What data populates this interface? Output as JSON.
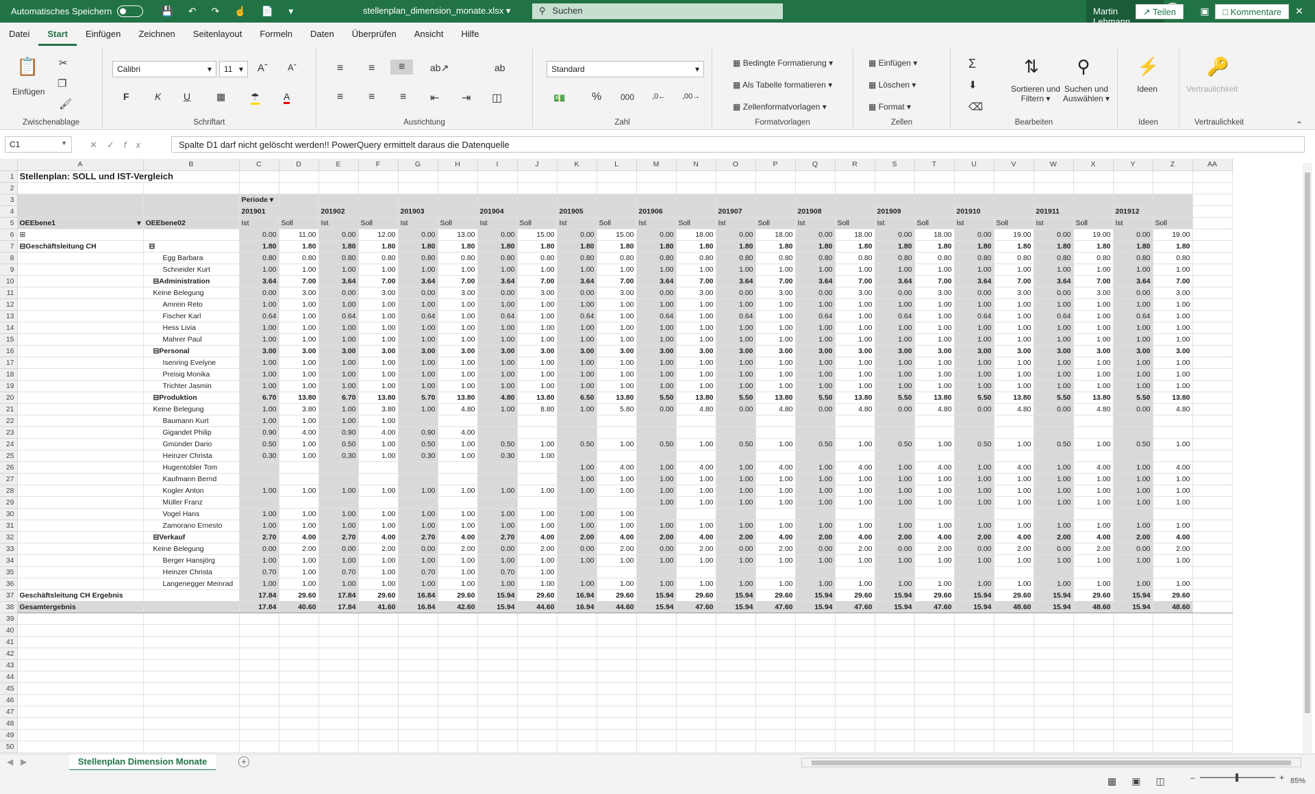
{
  "titlebar": {
    "autosave": "Automatisches Speichern",
    "filename": "stellenplan_dimension_monate.xlsx",
    "search_placeholder": "Suchen",
    "user": "Martin Lehmann"
  },
  "menu": [
    "Datei",
    "Start",
    "Einfügen",
    "Zeichnen",
    "Seitenlayout",
    "Formeln",
    "Daten",
    "Überprüfen",
    "Ansicht",
    "Hilfe"
  ],
  "share": "Teilen",
  "comments": "Kommentare",
  "ribbon": {
    "paste": "Einfügen",
    "clipboard": "Zwischenablage",
    "font_name": "Calibri",
    "font_size": "11",
    "font_group": "Schriftart",
    "bold": "F",
    "italic": "K",
    "underline": "U",
    "align_group": "Ausrichtung",
    "number_format": "Standard",
    "number_group": "Zahl",
    "cond_format": "Bedingte Formatierung",
    "as_table": "Als Tabelle formatieren",
    "cell_styles": "Zellenformatvorlagen",
    "styles_group": "Formatvorlagen",
    "insert": "Einfügen",
    "delete": "Löschen",
    "format": "Format",
    "cells_group": "Zellen",
    "sort": "Sortieren und",
    "sort2": "Filtern",
    "find": "Suchen und",
    "find2": "Auswählen",
    "edit_group": "Bearbeiten",
    "ideas": "Ideen",
    "ideas_group": "Ideen",
    "sensitivity": "Vertraulichkeit",
    "sensitivity_group": "Vertraulichkeit"
  },
  "namebox": "C1",
  "formula": "Spalte D1 darf nicht gelöscht werden!! PowerQuery ermittelt daraus die Datenquelle",
  "sheet_tab": "Stellenplan Dimension Monate",
  "zoom": "85%",
  "grid": {
    "columns": [
      "A",
      "B",
      "C",
      "D",
      "E",
      "F",
      "G",
      "H",
      "I",
      "J",
      "K",
      "L",
      "M",
      "N",
      "O",
      "P",
      "Q",
      "R",
      "S",
      "T",
      "U",
      "V",
      "W",
      "X",
      "Y",
      "Z",
      "AA"
    ],
    "title": "Stellenplan: SOLL und IST-Vergleich",
    "periode": "Periode",
    "periods": [
      "201901",
      "201902",
      "201903",
      "201904",
      "201905",
      "201906",
      "201907",
      "201908",
      "201909",
      "201910",
      "201911",
      "201912"
    ],
    "oe1": "OEEbene1",
    "oe2": "OEEbene02",
    "ist": "Ist",
    "soll": "Soll",
    "rows": [
      {
        "r": 6,
        "a": "⊞",
        "b": "",
        "v": [
          "0.00",
          "11.00",
          "0.00",
          "12.00",
          "0.00",
          "13.00",
          "0.00",
          "15.00",
          "0.00",
          "15.00",
          "0.00",
          "18.00",
          "0.00",
          "18.00",
          "0.00",
          "18.00",
          "0.00",
          "18.00",
          "0.00",
          "19.00",
          "0.00",
          "19.00",
          "0.00",
          "19.00"
        ]
      },
      {
        "r": 7,
        "a": "⊟Geschäftsleitung CH",
        "b": "⊟",
        "bold": true,
        "v": [
          "1.80",
          "1.80",
          "1.80",
          "1.80",
          "1.80",
          "1.80",
          "1.80",
          "1.80",
          "1.80",
          "1.80",
          "1.80",
          "1.80",
          "1.80",
          "1.80",
          "1.80",
          "1.80",
          "1.80",
          "1.80",
          "1.80",
          "1.80",
          "1.80",
          "1.80",
          "1.80",
          "1.80"
        ]
      },
      {
        "r": 8,
        "b": "Egg Barbara",
        "lvl": 2,
        "v": [
          "0.80",
          "0.80",
          "0.80",
          "0.80",
          "0.80",
          "0.80",
          "0.80",
          "0.80",
          "0.80",
          "0.80",
          "0.80",
          "0.80",
          "0.80",
          "0.80",
          "0.80",
          "0.80",
          "0.80",
          "0.80",
          "0.80",
          "0.80",
          "0.80",
          "0.80",
          "0.80",
          "0.80"
        ]
      },
      {
        "r": 9,
        "b": "Schneider Kurt",
        "lvl": 2,
        "v": [
          "1.00",
          "1.00",
          "1.00",
          "1.00",
          "1.00",
          "1.00",
          "1.00",
          "1.00",
          "1.00",
          "1.00",
          "1.00",
          "1.00",
          "1.00",
          "1.00",
          "1.00",
          "1.00",
          "1.00",
          "1.00",
          "1.00",
          "1.00",
          "1.00",
          "1.00",
          "1.00",
          "1.00"
        ]
      },
      {
        "r": 10,
        "b": "⊟Administration",
        "lvl": 1,
        "bold": true,
        "v": [
          "3.64",
          "7.00",
          "3.64",
          "7.00",
          "3.64",
          "7.00",
          "3.64",
          "7.00",
          "3.64",
          "7.00",
          "3.64",
          "7.00",
          "3.64",
          "7.00",
          "3.64",
          "7.00",
          "3.64",
          "7.00",
          "3.64",
          "7.00",
          "3.64",
          "7.00",
          "3.64",
          "7.00"
        ]
      },
      {
        "r": 11,
        "b": "Keine Belegung",
        "lvl": 1,
        "v": [
          "0.00",
          "3.00",
          "0.00",
          "3.00",
          "0.00",
          "3.00",
          "0.00",
          "3.00",
          "0.00",
          "3.00",
          "0.00",
          "3.00",
          "0.00",
          "3.00",
          "0.00",
          "3.00",
          "0.00",
          "3.00",
          "0.00",
          "3.00",
          "0.00",
          "3.00",
          "0.00",
          "3.00"
        ]
      },
      {
        "r": 12,
        "b": "Amrein Reto",
        "lvl": 2,
        "v": [
          "1.00",
          "1.00",
          "1.00",
          "1.00",
          "1.00",
          "1.00",
          "1.00",
          "1.00",
          "1.00",
          "1.00",
          "1.00",
          "1.00",
          "1.00",
          "1.00",
          "1.00",
          "1.00",
          "1.00",
          "1.00",
          "1.00",
          "1.00",
          "1.00",
          "1.00",
          "1.00",
          "1.00"
        ]
      },
      {
        "r": 13,
        "b": "Fischer Karl",
        "lvl": 2,
        "v": [
          "0.64",
          "1.00",
          "0.64",
          "1.00",
          "0.64",
          "1.00",
          "0.64",
          "1.00",
          "0.64",
          "1.00",
          "0.64",
          "1.00",
          "0.64",
          "1.00",
          "0.64",
          "1.00",
          "0.64",
          "1.00",
          "0.64",
          "1.00",
          "0.64",
          "1.00",
          "0.64",
          "1.00"
        ]
      },
      {
        "r": 14,
        "b": "Hess Livia",
        "lvl": 2,
        "v": [
          "1.00",
          "1.00",
          "1.00",
          "1.00",
          "1.00",
          "1.00",
          "1.00",
          "1.00",
          "1.00",
          "1.00",
          "1.00",
          "1.00",
          "1.00",
          "1.00",
          "1.00",
          "1.00",
          "1.00",
          "1.00",
          "1.00",
          "1.00",
          "1.00",
          "1.00",
          "1.00",
          "1.00"
        ]
      },
      {
        "r": 15,
        "b": "Mahrer Paul",
        "lvl": 2,
        "v": [
          "1.00",
          "1.00",
          "1.00",
          "1.00",
          "1.00",
          "1.00",
          "1.00",
          "1.00",
          "1.00",
          "1.00",
          "1.00",
          "1.00",
          "1.00",
          "1.00",
          "1.00",
          "1.00",
          "1.00",
          "1.00",
          "1.00",
          "1.00",
          "1.00",
          "1.00",
          "1.00",
          "1.00"
        ]
      },
      {
        "r": 16,
        "b": "⊟Personal",
        "lvl": 1,
        "bold": true,
        "v": [
          "3.00",
          "3.00",
          "3.00",
          "3.00",
          "3.00",
          "3.00",
          "3.00",
          "3.00",
          "3.00",
          "3.00",
          "3.00",
          "3.00",
          "3.00",
          "3.00",
          "3.00",
          "3.00",
          "3.00",
          "3.00",
          "3.00",
          "3.00",
          "3.00",
          "3.00",
          "3.00",
          "3.00"
        ]
      },
      {
        "r": 17,
        "b": "Isenring Evelyne",
        "lvl": 2,
        "v": [
          "1.00",
          "1.00",
          "1.00",
          "1.00",
          "1.00",
          "1.00",
          "1.00",
          "1.00",
          "1.00",
          "1.00",
          "1.00",
          "1.00",
          "1.00",
          "1.00",
          "1.00",
          "1.00",
          "1.00",
          "1.00",
          "1.00",
          "1.00",
          "1.00",
          "1.00",
          "1.00",
          "1.00"
        ]
      },
      {
        "r": 18,
        "b": "Preisig Monika",
        "lvl": 2,
        "v": [
          "1.00",
          "1.00",
          "1.00",
          "1.00",
          "1.00",
          "1.00",
          "1.00",
          "1.00",
          "1.00",
          "1.00",
          "1.00",
          "1.00",
          "1.00",
          "1.00",
          "1.00",
          "1.00",
          "1.00",
          "1.00",
          "1.00",
          "1.00",
          "1.00",
          "1.00",
          "1.00",
          "1.00"
        ]
      },
      {
        "r": 19,
        "b": "Trichter Jasmin",
        "lvl": 2,
        "v": [
          "1.00",
          "1.00",
          "1.00",
          "1.00",
          "1.00",
          "1.00",
          "1.00",
          "1.00",
          "1.00",
          "1.00",
          "1.00",
          "1.00",
          "1.00",
          "1.00",
          "1.00",
          "1.00",
          "1.00",
          "1.00",
          "1.00",
          "1.00",
          "1.00",
          "1.00",
          "1.00",
          "1.00"
        ]
      },
      {
        "r": 20,
        "b": "⊟Produktion",
        "lvl": 1,
        "bold": true,
        "v": [
          "6.70",
          "13.80",
          "6.70",
          "13.80",
          "5.70",
          "13.80",
          "4.80",
          "13.80",
          "6.50",
          "13.80",
          "5.50",
          "13.80",
          "5.50",
          "13.80",
          "5.50",
          "13.80",
          "5.50",
          "13.80",
          "5.50",
          "13.80",
          "5.50",
          "13.80",
          "5.50",
          "13.80"
        ]
      },
      {
        "r": 21,
        "b": "Keine Belegung",
        "lvl": 1,
        "v": [
          "1.00",
          "3.80",
          "1.00",
          "3.80",
          "1.00",
          "4.80",
          "1.00",
          "8.80",
          "1.00",
          "5.80",
          "0.00",
          "4.80",
          "0.00",
          "4.80",
          "0.00",
          "4.80",
          "0.00",
          "4.80",
          "0.00",
          "4.80",
          "0.00",
          "4.80",
          "0.00",
          "4.80"
        ]
      },
      {
        "r": 22,
        "b": "Baumann Kurt",
        "lvl": 2,
        "v": [
          "1.00",
          "1.00",
          "1.00",
          "1.00",
          "",
          "",
          "",
          "",
          "",
          "",
          "",
          "",
          "",
          "",
          "",
          "",
          "",
          "",
          "",
          "",
          "",
          "",
          "",
          ""
        ]
      },
      {
        "r": 23,
        "b": "Gigandet Philip",
        "lvl": 2,
        "v": [
          "0.90",
          "4.00",
          "0.90",
          "4.00",
          "0.90",
          "4.00",
          "",
          "",
          "",
          "",
          "",
          "",
          "",
          "",
          "",
          "",
          "",
          "",
          "",
          "",
          "",
          "",
          "",
          ""
        ]
      },
      {
        "r": 24,
        "b": "Gmünder Dario",
        "lvl": 2,
        "v": [
          "0.50",
          "1.00",
          "0.50",
          "1.00",
          "0.50",
          "1.00",
          "0.50",
          "1.00",
          "0.50",
          "1.00",
          "0.50",
          "1.00",
          "0.50",
          "1.00",
          "0.50",
          "1.00",
          "0.50",
          "1.00",
          "0.50",
          "1.00",
          "0.50",
          "1.00",
          "0.50",
          "1.00"
        ]
      },
      {
        "r": 25,
        "b": "Heinzer Christa",
        "lvl": 2,
        "v": [
          "0.30",
          "1.00",
          "0.30",
          "1.00",
          "0.30",
          "1.00",
          "0.30",
          "1.00",
          "",
          "",
          "",
          "",
          "",
          "",
          "",
          "",
          "",
          "",
          "",
          "",
          "",
          "",
          "",
          ""
        ]
      },
      {
        "r": 26,
        "b": "Hugentobler Tom",
        "lvl": 2,
        "v": [
          "",
          "",
          "",
          "",
          "",
          "",
          "",
          "",
          "1.00",
          "4.00",
          "1.00",
          "4.00",
          "1.00",
          "4.00",
          "1.00",
          "4.00",
          "1.00",
          "4.00",
          "1.00",
          "4.00",
          "1.00",
          "4.00",
          "1.00",
          "4.00"
        ]
      },
      {
        "r": 27,
        "b": "Kaufmann Bernd",
        "lvl": 2,
        "v": [
          "",
          "",
          "",
          "",
          "",
          "",
          "",
          "",
          "1.00",
          "1.00",
          "1.00",
          "1.00",
          "1.00",
          "1.00",
          "1.00",
          "1.00",
          "1.00",
          "1.00",
          "1.00",
          "1.00",
          "1.00",
          "1.00",
          "1.00",
          "1.00"
        ]
      },
      {
        "r": 28,
        "b": "Kogler Anton",
        "lvl": 2,
        "v": [
          "1.00",
          "1.00",
          "1.00",
          "1.00",
          "1.00",
          "1.00",
          "1.00",
          "1.00",
          "1.00",
          "1.00",
          "1.00",
          "1.00",
          "1.00",
          "1.00",
          "1.00",
          "1.00",
          "1.00",
          "1.00",
          "1.00",
          "1.00",
          "1.00",
          "1.00",
          "1.00",
          "1.00"
        ]
      },
      {
        "r": 29,
        "b": "Müller Franz",
        "lvl": 2,
        "v": [
          "",
          "",
          "",
          "",
          "",
          "",
          "",
          "",
          "",
          "",
          "1.00",
          "1.00",
          "1.00",
          "1.00",
          "1.00",
          "1.00",
          "1.00",
          "1.00",
          "1.00",
          "1.00",
          "1.00",
          "1.00",
          "1.00",
          "1.00"
        ]
      },
      {
        "r": 30,
        "b": "Vogel Hans",
        "lvl": 2,
        "v": [
          "1.00",
          "1.00",
          "1.00",
          "1.00",
          "1.00",
          "1.00",
          "1.00",
          "1.00",
          "1.00",
          "1.00",
          "",
          "",
          "",
          "",
          "",
          "",
          "",
          "",
          "",
          "",
          "",
          "",
          "",
          ""
        ]
      },
      {
        "r": 31,
        "b": "Zamorano Ernesto",
        "lvl": 2,
        "v": [
          "1.00",
          "1.00",
          "1.00",
          "1.00",
          "1.00",
          "1.00",
          "1.00",
          "1.00",
          "1.00",
          "1.00",
          "1.00",
          "1.00",
          "1.00",
          "1.00",
          "1.00",
          "1.00",
          "1.00",
          "1.00",
          "1.00",
          "1.00",
          "1.00",
          "1.00",
          "1.00",
          "1.00"
        ]
      },
      {
        "r": 32,
        "b": "⊟Verkauf",
        "lvl": 1,
        "bold": true,
        "v": [
          "2.70",
          "4.00",
          "2.70",
          "4.00",
          "2.70",
          "4.00",
          "2.70",
          "4.00",
          "2.00",
          "4.00",
          "2.00",
          "4.00",
          "2.00",
          "4.00",
          "2.00",
          "4.00",
          "2.00",
          "4.00",
          "2.00",
          "4.00",
          "2.00",
          "4.00",
          "2.00",
          "4.00"
        ]
      },
      {
        "r": 33,
        "b": "Keine Belegung",
        "lvl": 1,
        "v": [
          "0.00",
          "2.00",
          "0.00",
          "2.00",
          "0.00",
          "2.00",
          "0.00",
          "2.00",
          "0.00",
          "2.00",
          "0.00",
          "2.00",
          "0.00",
          "2.00",
          "0.00",
          "2.00",
          "0.00",
          "2.00",
          "0.00",
          "2.00",
          "0.00",
          "2.00",
          "0.00",
          "2.00"
        ]
      },
      {
        "r": 34,
        "b": "Berger Hansjörg",
        "lvl": 2,
        "v": [
          "1.00",
          "1.00",
          "1.00",
          "1.00",
          "1.00",
          "1.00",
          "1.00",
          "1.00",
          "1.00",
          "1.00",
          "1.00",
          "1.00",
          "1.00",
          "1.00",
          "1.00",
          "1.00",
          "1.00",
          "1.00",
          "1.00",
          "1.00",
          "1.00",
          "1.00",
          "1.00",
          "1.00"
        ]
      },
      {
        "r": 35,
        "b": "Heinzer Christa",
        "lvl": 2,
        "v": [
          "0.70",
          "1.00",
          "0.70",
          "1.00",
          "0.70",
          "1.00",
          "0.70",
          "1.00",
          "",
          "",
          "",
          "",
          "",
          "",
          "",
          "",
          "",
          "",
          "",
          "",
          "",
          "",
          "",
          ""
        ]
      },
      {
        "r": 36,
        "b": "Langenegger Meinrad",
        "lvl": 2,
        "v": [
          "1.00",
          "1.00",
          "1.00",
          "1.00",
          "1.00",
          "1.00",
          "1.00",
          "1.00",
          "1.00",
          "1.00",
          "1.00",
          "1.00",
          "1.00",
          "1.00",
          "1.00",
          "1.00",
          "1.00",
          "1.00",
          "1.00",
          "1.00",
          "1.00",
          "1.00",
          "1.00",
          "1.00"
        ]
      },
      {
        "r": 37,
        "a": "Geschäftsleitung CH Ergebnis",
        "total": true,
        "v": [
          "17.84",
          "29.60",
          "17.84",
          "29.60",
          "16.84",
          "29.60",
          "15.94",
          "29.60",
          "16.94",
          "29.60",
          "15.94",
          "29.60",
          "15.94",
          "29.60",
          "15.94",
          "29.60",
          "15.94",
          "29.60",
          "15.94",
          "29.60",
          "15.94",
          "29.60",
          "15.94",
          "29.60"
        ]
      },
      {
        "r": 38,
        "a": "Gesamtergebnis",
        "grand": true,
        "v": [
          "17.84",
          "40.60",
          "17.84",
          "41.60",
          "16.84",
          "42.60",
          "15.94",
          "44.60",
          "16.94",
          "44.60",
          "15.94",
          "47.60",
          "15.94",
          "47.60",
          "15.94",
          "47.60",
          "15.94",
          "47.60",
          "15.94",
          "48.60",
          "15.94",
          "48.60",
          "15.94",
          "48.60"
        ]
      }
    ],
    "empty_rows": [
      39,
      40,
      41,
      42,
      43,
      44,
      45,
      46,
      47,
      48,
      49,
      50
    ]
  }
}
